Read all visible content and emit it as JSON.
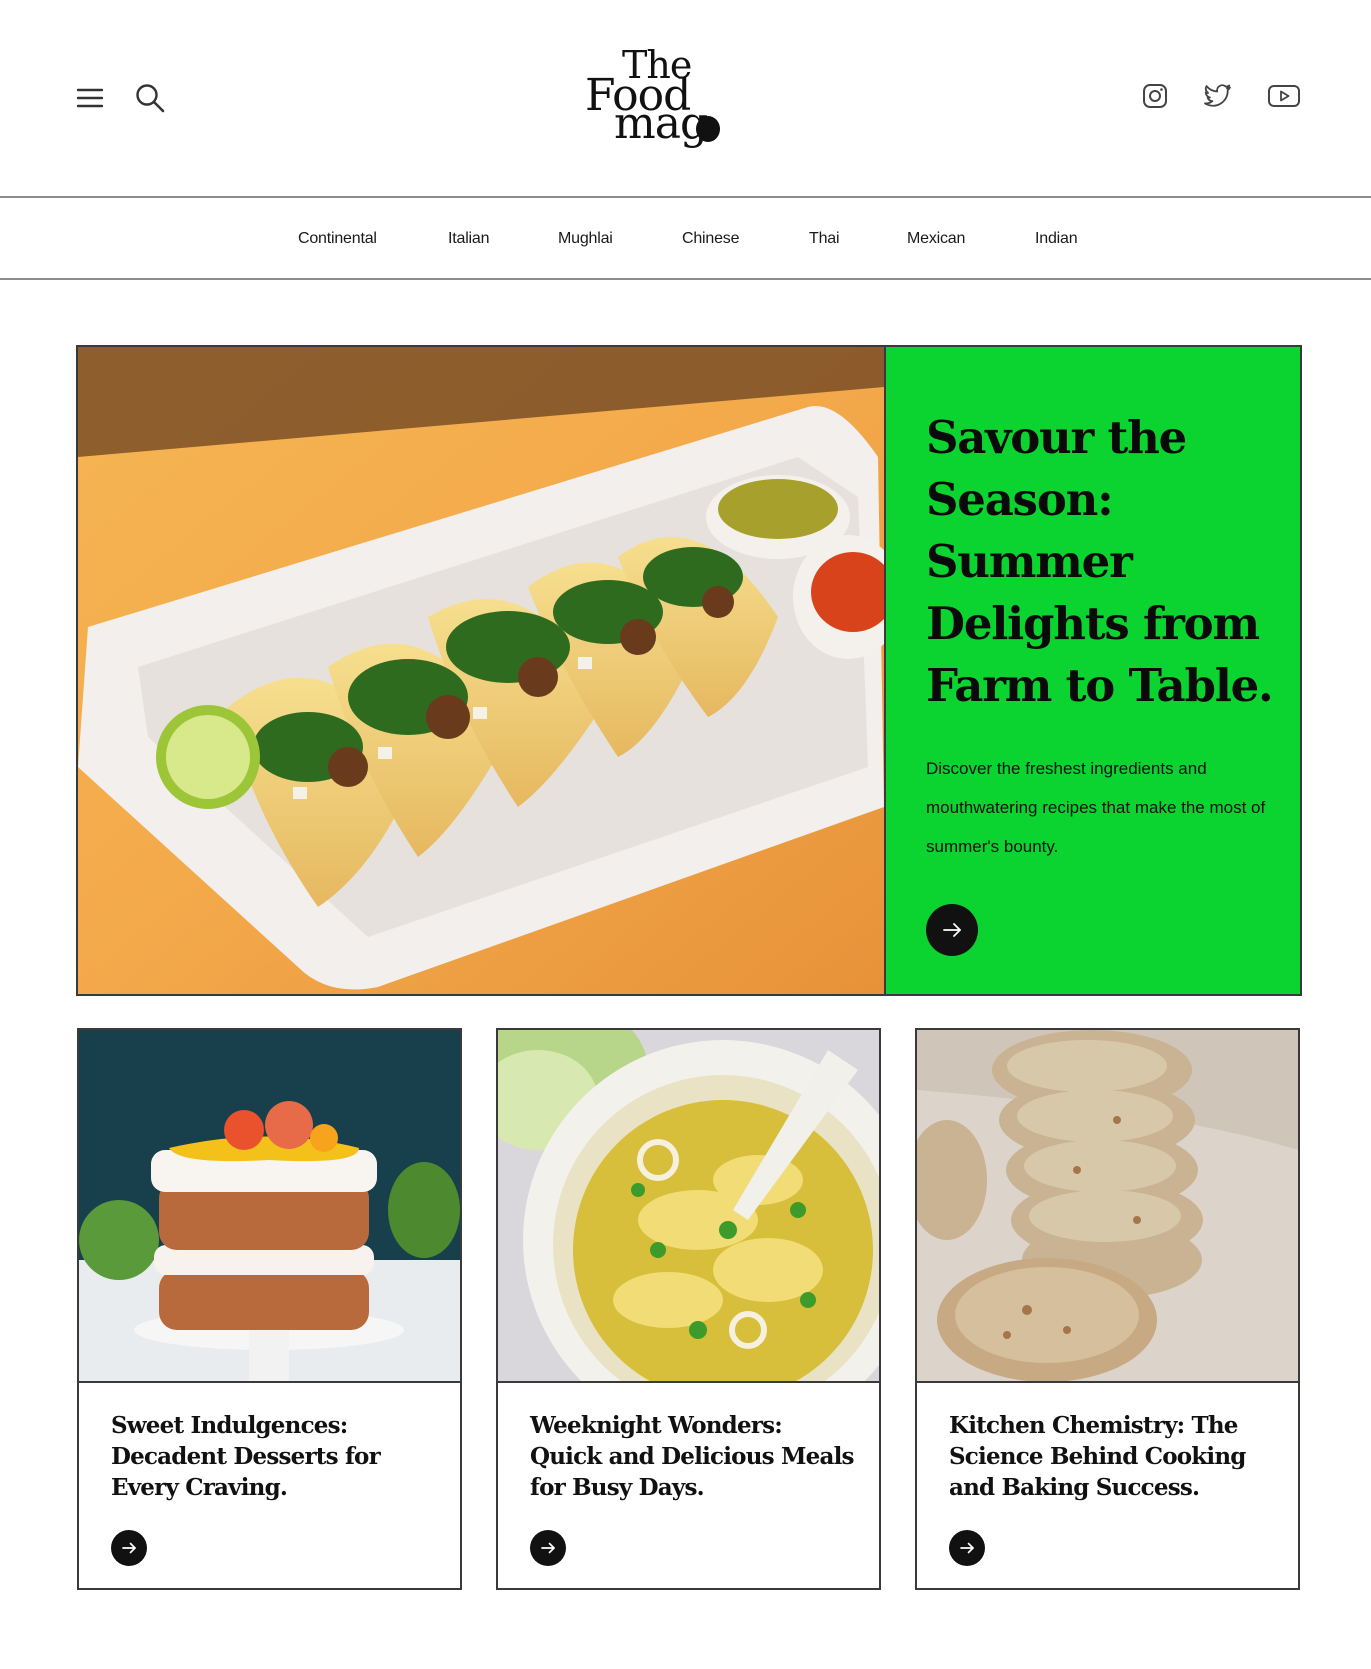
{
  "header": {
    "logo_line1": "The",
    "logo_line2": "Food",
    "logo_line3": "mag",
    "left_icons": [
      "menu-icon",
      "search-icon"
    ],
    "social_icons": [
      "instagram-icon",
      "twitter-icon",
      "youtube-icon"
    ]
  },
  "categories": [
    "Continental",
    "Italian",
    "Mughlai",
    "Chinese",
    "Thai",
    "Mexican",
    "Indian"
  ],
  "hero": {
    "title": "Savour the Season: Summer Delights from Farm to Table.",
    "description": "Discover the freshest ingredients and mouthwatering recipes that make the most of summer's bounty.",
    "accent_color": "#0bd32f",
    "image": "tacos-photo",
    "cta_icon": "arrow-right-icon"
  },
  "cards": [
    {
      "title": "Sweet Indulgences: Decadent Desserts for Every Craving.",
      "image": "layered-cake-photo",
      "cta_icon": "arrow-right-icon"
    },
    {
      "title": "Weeknight Wonders: Quick and Delicious Meals for Busy Days.",
      "image": "noodle-soup-photo",
      "cta_icon": "arrow-right-icon"
    },
    {
      "title": "Kitchen Chemistry: The Science Behind Cooking and Baking Success.",
      "image": "oat-cookies-photo",
      "cta_icon": "arrow-right-icon"
    }
  ]
}
